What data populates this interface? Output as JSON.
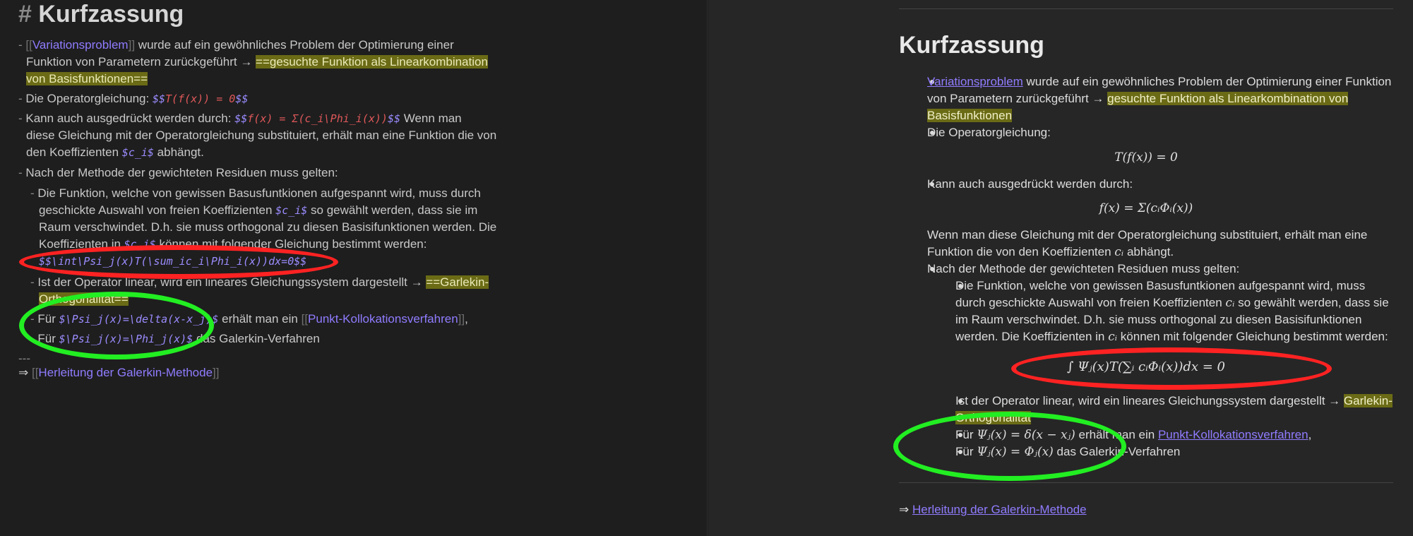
{
  "editor": {
    "heading_marker": "# ",
    "heading": "Kurfzassung",
    "bullet": "- ",
    "item1": {
      "link": "Variationsproblem",
      "text_a": " wurde auf ein gewöhnliches Problem der Optimierung einer",
      "text_b": "Funktion von Parametern zurückgeführt → ",
      "highlight_a": "==gesuchte Funktion als Linearkombination",
      "highlight_b": "von Basisfunktionen=="
    },
    "item2": {
      "text": "Die Operatorgleichung: ",
      "math_open": "$$",
      "math": "T(f(x)) = 0",
      "math_close": "$$"
    },
    "item3": {
      "text_a": "Kann auch ausgedrückt werden durch: ",
      "math_open": "$$",
      "math": "f(x) = Σ(c_i\\Phi_i(x))",
      "math_close": "$$",
      "text_b": " Wenn man",
      "text_c": "diese Gleichung mit der Operatorgleichung substituiert, erhält man eine Funktion die von",
      "text_d": "den Koeffizienten ",
      "math_inline": "$c_i$",
      "text_e": " abhängt."
    },
    "item4": {
      "text": "Nach der Methode der gewichteten Residuen muss gelten:"
    },
    "sub1": {
      "text_a": "Die Funktion, welche von gewissen Basusfuntkionen aufgespannt wird, muss durch",
      "text_b": "geschickte Auswahl von freien Koeffizienten ",
      "math_inline": "$c_i$",
      "text_c": " so gewählt werden, dass sie im",
      "text_d": "Raum verschwindet. D.h. sie muss orthogonal zu diesen Basisifunktionen werden. Die",
      "text_e": "Koeffizienten in ",
      "text_f": " können mit folgender Gleichung bestimmt werden:",
      "math_block": "$$\\int\\Psi_j(x)T(\\sum_ic_i\\Phi_i(x))dx=0$$"
    },
    "sub2": {
      "text_a": "Ist der Operator linear, wird ein lineares Gleichungssystem dargestellt → ",
      "highlight_a": "==Garlekin-",
      "highlight_b": "Orthogonalität=="
    },
    "sub3": {
      "text_a": "Für ",
      "math": "$\\Psi_j(x)=\\delta(x-x_j)$",
      "text_b": " erhält man ein ",
      "link": "Punkt-Kollokationsverfahren",
      "text_c": ","
    },
    "sub4": {
      "text_a": "Für ",
      "math": "$\\Psi_j(x)=\\Phi_j(x)$",
      "text_b": " das Galerkin-Verfahren"
    },
    "hr": "---",
    "footer_arrow": "⇒ ",
    "footer_link": "Herleitung der Galerkin-Methode",
    "link_open": "[[",
    "link_close": "]]"
  },
  "reading": {
    "heading": "Kurfzassung",
    "item1": {
      "link": "Variationsproblem",
      "text_a": " wurde auf ein gewöhnliches Problem der Optimierung einer Funktion",
      "text_b": "von Parametern zurückgeführt → ",
      "highlight_a": "gesuchte Funktion als Linearkombination von",
      "highlight_b": "Basisfunktionen"
    },
    "item2": {
      "text": "Die Operatorgleichung:",
      "formula": "T(f(x)) = 0"
    },
    "item3": {
      "text": "Kann auch ausgedrückt werden durch:",
      "formula": "f(x) = Σ(cᵢΦᵢ(x))",
      "para_a": "Wenn man diese Gleichung mit der Operatorgleichung substituiert, erhält man eine",
      "para_b": "Funktion die von den Koeffizienten ",
      "para_sym": "cᵢ",
      "para_c": " abhängt."
    },
    "item4": {
      "text": "Nach der Methode der gewichteten Residuen muss gelten:"
    },
    "sub1": {
      "text_a": "Die Funktion, welche von gewissen Basusfuntkionen aufgespannt wird, muss",
      "text_b": "durch geschickte Auswahl von freien Koeffizienten ",
      "sym": "cᵢ",
      "text_c": " so gewählt werden, dass sie",
      "text_d": "im Raum verschwindet. D.h. sie muss orthogonal zu diesen Basisifunktionen",
      "text_e": "werden. Die Koeffizienten in ",
      "text_f": " können mit folgender Gleichung bestimmt werden:",
      "formula": "∫ Ψⱼ(x)T(∑ᵢ cᵢΦᵢ(x))dx = 0"
    },
    "sub2": {
      "text_a": "Ist der Operator linear, wird ein lineares Gleichungssystem dargestellt → ",
      "highlight_a": "Garlekin-",
      "highlight_b": "Orthogonalität"
    },
    "sub3": {
      "text_a": "Für ",
      "formula": "Ψⱼ(x) = δ(x − xⱼ)",
      "text_b": " erhält man ein ",
      "link": "Punkt-Kollokationsverfahren",
      "text_c": ","
    },
    "sub4": {
      "text_a": "Für ",
      "formula": "Ψⱼ(x) = Φⱼ(x)",
      "text_b": " das Galerkin-Verfahren"
    },
    "footer_arrow": "⇒ ",
    "footer_link": "Herleitung der Galerkin-Methode"
  },
  "annotations": {
    "red": "#ff2222",
    "green": "#22ee22"
  }
}
